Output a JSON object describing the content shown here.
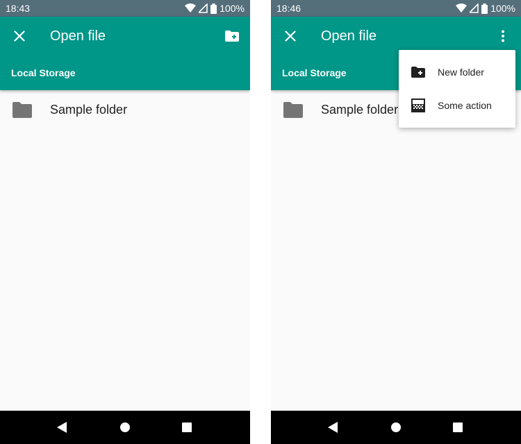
{
  "screens": [
    {
      "status_bar": {
        "time": "18:43",
        "battery": "100%"
      },
      "app_bar": {
        "title": "Open file",
        "subtitle": "Local Storage",
        "action_icon": "create-folder-icon"
      },
      "list": [
        {
          "label": "Sample folder",
          "icon": "folder-icon"
        }
      ]
    },
    {
      "status_bar": {
        "time": "18:46",
        "battery": "100%"
      },
      "app_bar": {
        "title": "Open file",
        "subtitle": "Local Storage",
        "action_icon": "more-vert-icon"
      },
      "list": [
        {
          "label": "Sample folder",
          "icon": "folder-icon"
        }
      ],
      "overflow_menu": [
        {
          "label": "New folder",
          "icon": "create-folder-icon"
        },
        {
          "label": "Some action",
          "icon": "gradient-icon"
        }
      ]
    }
  ],
  "colors": {
    "app_bar": "#009688",
    "status_bar": "#546e7a",
    "background": "#fafafa",
    "navigation_bar": "#000000",
    "folder_icon": "#757575"
  }
}
